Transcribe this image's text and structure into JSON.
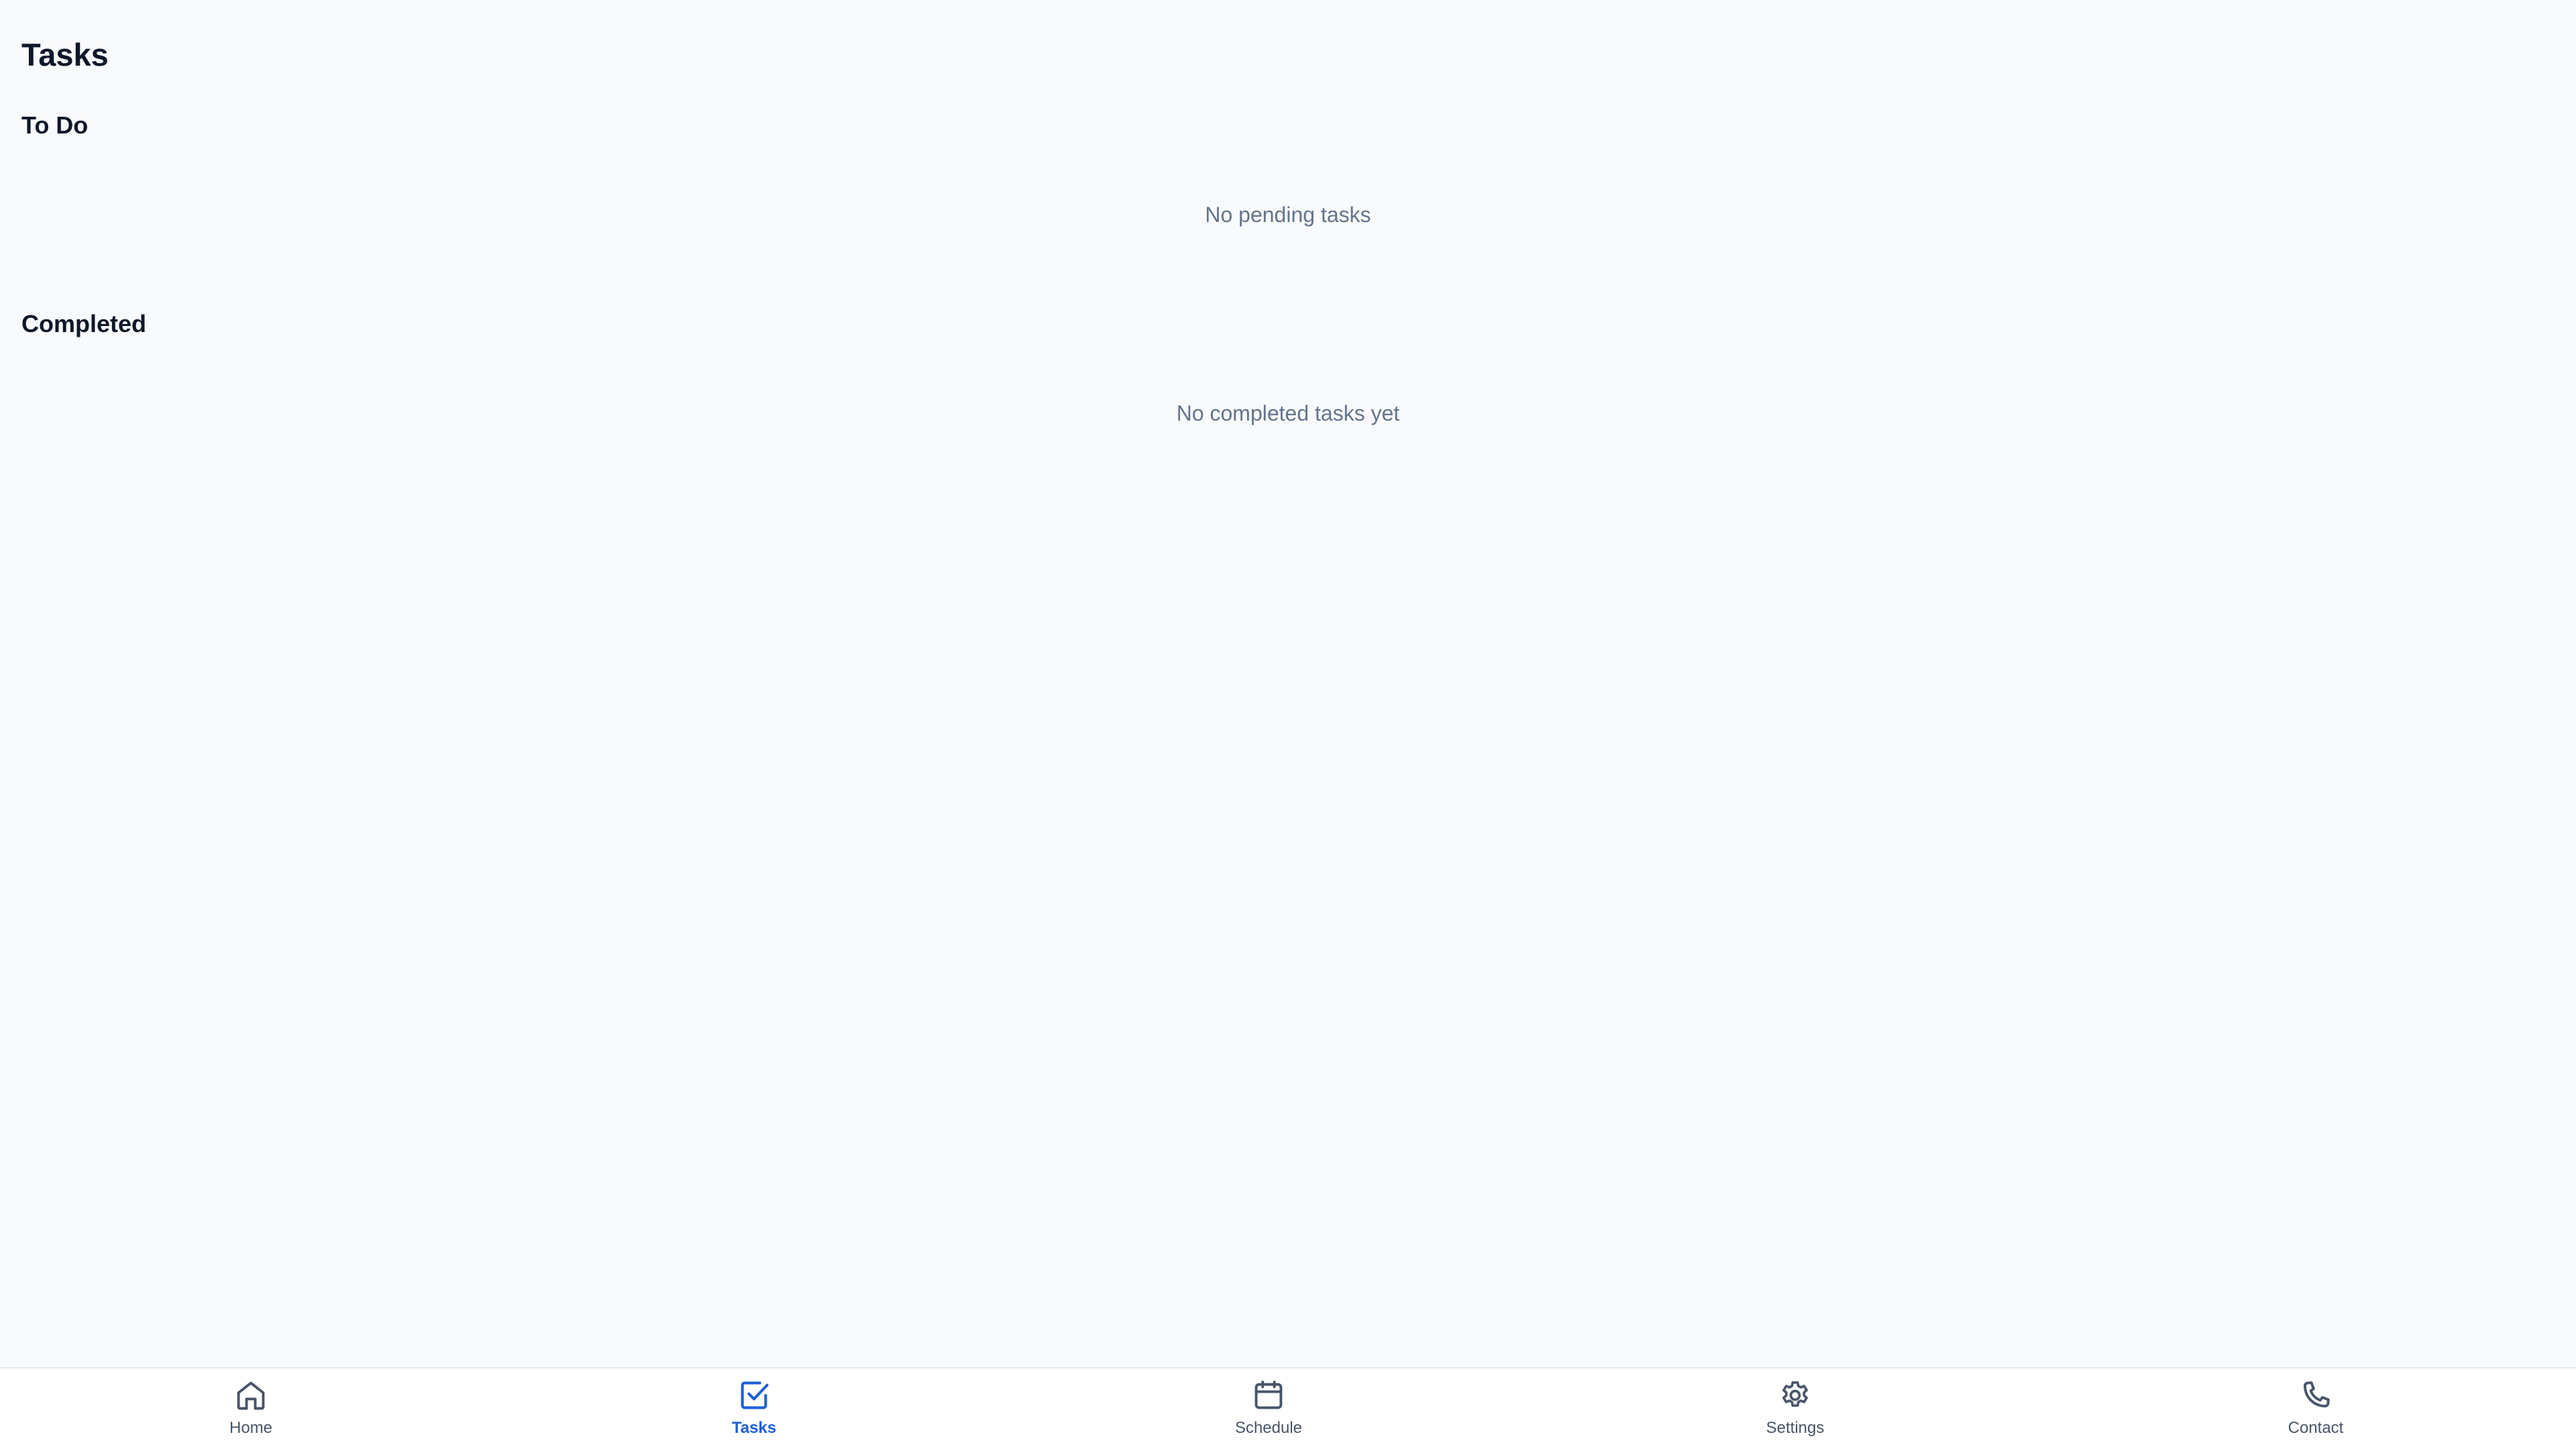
{
  "page": {
    "title": "Tasks"
  },
  "sections": {
    "todo": {
      "title": "To Do",
      "empty_text": "No pending tasks"
    },
    "completed": {
      "title": "Completed",
      "empty_text": "No completed tasks yet"
    }
  },
  "bottom_nav": {
    "items": [
      {
        "label": "Home",
        "icon": "home-icon",
        "active": false
      },
      {
        "label": "Tasks",
        "icon": "checkbox-icon",
        "active": true
      },
      {
        "label": "Schedule",
        "icon": "calendar-icon",
        "active": false
      },
      {
        "label": "Settings",
        "icon": "gear-icon",
        "active": false
      },
      {
        "label": "Contact",
        "icon": "phone-icon",
        "active": false
      }
    ]
  },
  "colors": {
    "background": "#f8fafc",
    "nav_background": "#ffffff",
    "active": "#1d5fd8",
    "inactive": "#475569",
    "muted_text": "#64748b",
    "heading_text": "#0f172a"
  }
}
